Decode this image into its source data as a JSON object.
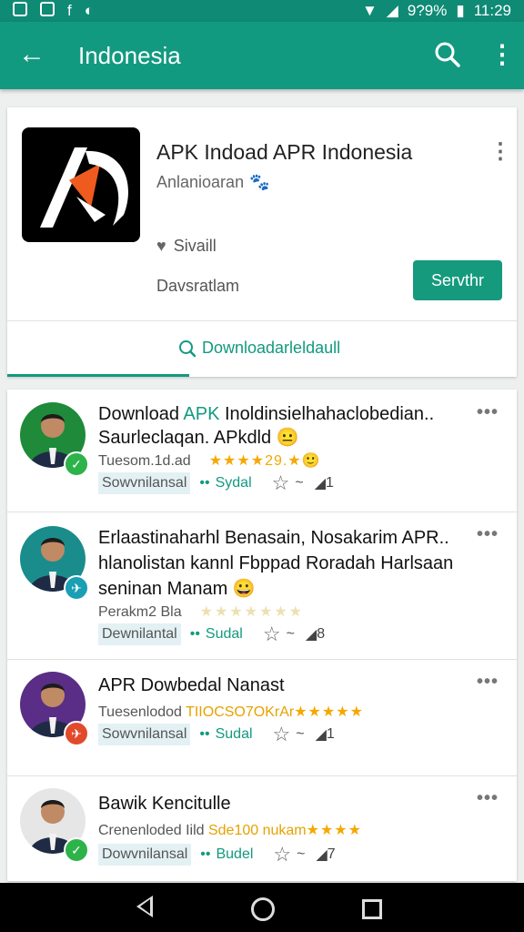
{
  "status_bar": {
    "battery": "9?9%",
    "time": "11:29"
  },
  "app_bar": {
    "title": "Indonesia"
  },
  "app_card": {
    "title": "APK Indoad APR Indonesia",
    "developer": "Anlanioaran",
    "wishlist_label": "Sivaill",
    "size_label": "Davsratlam",
    "install_label": "Servthr",
    "tab_label": "Downloadarleldaull",
    "accent": "#129a80"
  },
  "reviews": [
    {
      "title_line1_prefix": "Download ",
      "title_line1_highlight": "APK",
      "title_line1_rest": " Inoldinsielhahaclobedian..",
      "title_line2": "Saurleclaqan. APkdld 😐",
      "meta_text": "Tuesom.1d.ad",
      "meta_rating": "★★★★29.★",
      "meta_extra": "🙂",
      "chip_label": "Sowvnilansal",
      "action_label": "Sydal",
      "count": "1",
      "badge_color": "#2db34a",
      "badge_icon": "check-icon"
    },
    {
      "title_line1": "Erlaastinaharhl Benasain, Nosakarim APR..",
      "title_line2": "hlanolistan kannl Fbppad Roradah Harlsaan",
      "title_line3": "seninan Manam 😀",
      "meta_text": "Perakm2 Bla",
      "meta_rating": "★★★★★★★",
      "chip_label": "Dewnilantal",
      "action_label": "Sudal",
      "count": "8",
      "badge_color": "#1a9fb5",
      "badge_icon": "plane-icon"
    },
    {
      "title_line1": "APR Dowbedal Nanast",
      "meta_text": "Tuesenlodod ",
      "meta_rating_text": "TIIOCSO7OKrAr",
      "meta_rating": "★★★★★",
      "chip_label": "Sowvnilansal",
      "action_label": "Sudal",
      "count": "1",
      "badge_color": "#e24a2c",
      "badge_icon": "plane-icon"
    },
    {
      "title_line1": "Bawik Kencitulle",
      "meta_text": "Crenenloded Iild ",
      "meta_rating_text": "Sde100 nukam",
      "meta_rating": "★★★★",
      "chip_label": "Dowvnilansal",
      "action_label": "Budel",
      "count": "7",
      "badge_color": "#2db34a",
      "badge_icon": "check-icon"
    }
  ]
}
